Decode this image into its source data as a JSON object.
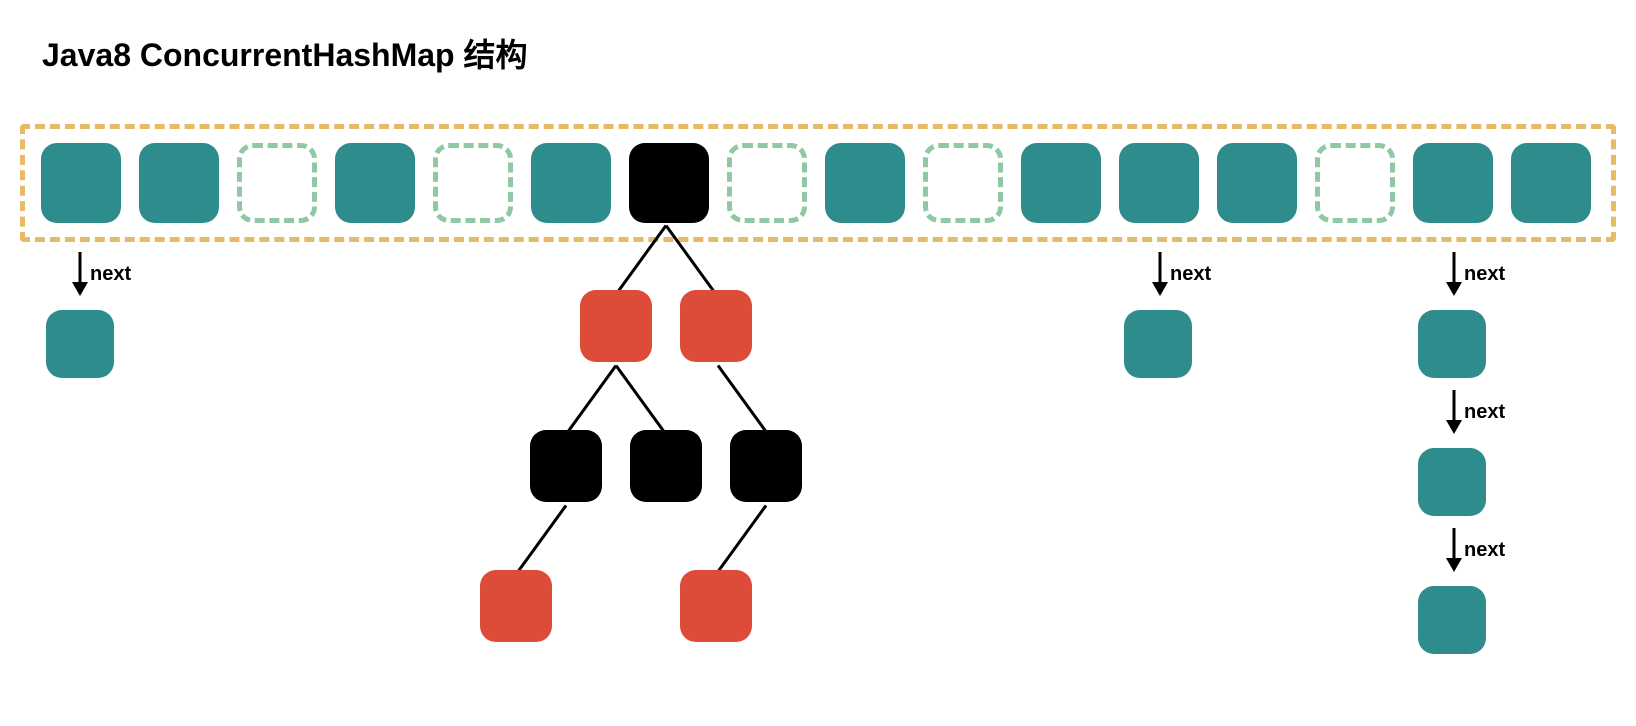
{
  "title": "Java8 ConcurrentHashMap 结构",
  "labels": {
    "next": "next"
  },
  "colors": {
    "teal": "#2f8c8c",
    "empty_border": "#8fc9a3",
    "container_border": "#e8b966",
    "black": "#000000",
    "red": "#dd4b39"
  },
  "table": [
    {
      "type": "filled"
    },
    {
      "type": "filled"
    },
    {
      "type": "empty"
    },
    {
      "type": "filled"
    },
    {
      "type": "empty"
    },
    {
      "type": "filled"
    },
    {
      "type": "black"
    },
    {
      "type": "empty"
    },
    {
      "type": "filled"
    },
    {
      "type": "empty"
    },
    {
      "type": "filled"
    },
    {
      "type": "filled"
    },
    {
      "type": "filled"
    },
    {
      "type": "empty"
    },
    {
      "type": "filled"
    },
    {
      "type": "filled"
    }
  ],
  "chains": [
    {
      "bucket_index": 0,
      "nodes": 1
    },
    {
      "bucket_index": 11,
      "nodes": 1
    },
    {
      "bucket_index": 14,
      "nodes": 3
    }
  ],
  "tree": {
    "bucket_index": 6,
    "structure": "red-black-tree",
    "root": "black",
    "level1": [
      "red",
      "red"
    ],
    "level2": [
      "black",
      "black",
      "black"
    ],
    "level3": [
      "red",
      "red"
    ]
  }
}
